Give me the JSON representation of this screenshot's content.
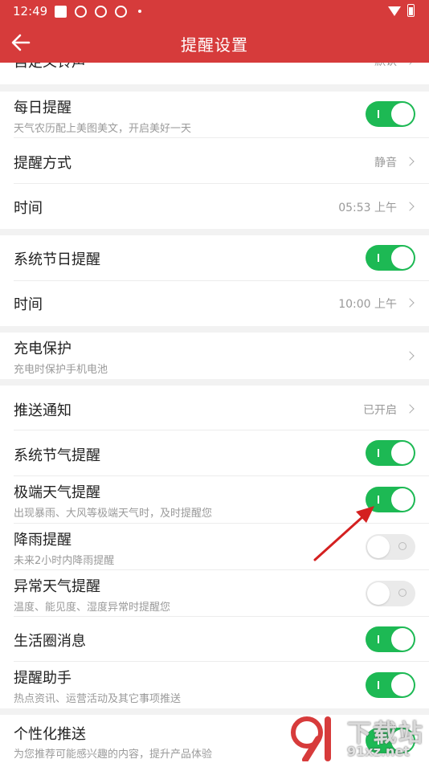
{
  "status_bar": {
    "time": "12:49"
  },
  "header": {
    "title": "提醒设置"
  },
  "rows": {
    "custom_ringtone": {
      "label": "自定义铃声",
      "value": "默认"
    },
    "daily": {
      "label": "每日提醒",
      "sub": "天气农历配上美图美文，开启美好一天",
      "on": true
    },
    "method": {
      "label": "提醒方式",
      "value": "静音"
    },
    "daily_time": {
      "label": "时间",
      "value": "05:53 上午"
    },
    "holiday": {
      "label": "系统节日提醒",
      "on": true
    },
    "holiday_time": {
      "label": "时间",
      "value": "10:00 上午"
    },
    "charging": {
      "label": "充电保护",
      "sub": "充电时保护手机电池"
    },
    "push": {
      "label": "推送通知",
      "value": "已开启"
    },
    "solar_term": {
      "label": "系统节气提醒",
      "on": true
    },
    "extreme": {
      "label": "极端天气提醒",
      "sub": "出现暴雨、大风等极端天气时，及时提醒您",
      "on": true
    },
    "rain": {
      "label": "降雨提醒",
      "sub": "未来2小时内降雨提醒",
      "on": false
    },
    "abnormal": {
      "label": "异常天气提醒",
      "sub": "温度、能见度、湿度异常时提醒您",
      "on": false
    },
    "life_circle": {
      "label": "生活圈消息",
      "on": true
    },
    "assistant": {
      "label": "提醒助手",
      "sub": "热点资讯、运营活动及其它事项推送",
      "on": true
    },
    "personalized": {
      "label": "个性化推送",
      "sub": "为您推荐可能感兴趣的内容，提升产品体验",
      "on": true
    }
  },
  "watermark": {
    "cn": "下载站",
    "en": "91xz.net"
  },
  "colors": {
    "brand_red": "#d63b3b",
    "toggle_on": "#1db954",
    "annotation_arrow": "#d42020"
  }
}
